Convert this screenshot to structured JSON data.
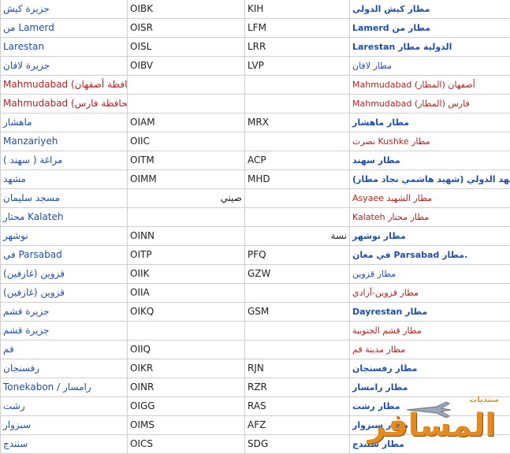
{
  "rows": [
    {
      "city": "جزيرة كيش",
      "icao": "OIBK",
      "iata": "KIH",
      "airport": "مطار كيش الدولي",
      "city_red": false,
      "airport_red": false
    },
    {
      "city": "من Lamerd",
      "icao": "OISR",
      "iata": "LFM",
      "airport": "Lamerd مطار من",
      "city_red": false,
      "airport_red": false
    },
    {
      "city": "Larestan",
      "icao": "OISL",
      "iata": "LRR",
      "airport": "Larestan الدولية مطار",
      "city_red": false,
      "airport_red": false
    },
    {
      "city": "جزيرة لافان",
      "icao": "OIBV",
      "iata": "LVP",
      "airport": "مطار لافان",
      "city_red": false,
      "airport_red": false,
      "airport_plain": true
    },
    {
      "city": "Mahmudabad (محافظة أصفهان)",
      "icao": "",
      "iata": "",
      "airport": "Mahmudabad أصفهان (المطار)",
      "city_red": true,
      "airport_red": true
    },
    {
      "city": "Mahmudabad (محافظة فارس)",
      "icao": "",
      "iata": "",
      "airport": "Mahmudabad فارس (المطار)",
      "city_red": true,
      "airport_red": true
    },
    {
      "city": "ماهشار",
      "icao": "OIAM",
      "iata": "MRX",
      "airport": "مطار ماهشار",
      "city_red": false,
      "airport_red": false
    },
    {
      "city": "Manzariyeh",
      "icao": "OIIC",
      "iata": "",
      "airport": "نصرت Kushke مطار",
      "city_red": false,
      "airport_red": true
    },
    {
      "city": "( مراغة ( سهند",
      "icao": "OITM",
      "iata": "ACP",
      "airport": "مطار سهند",
      "city_red": false,
      "airport_red": false
    },
    {
      "city": "مشهد",
      "icao": "OIMM",
      "iata": "MHD",
      "airport": "(مطار مشهد الدولي (شهيد هاشمي نجاد مطار",
      "city_red": false,
      "airport_red": false
    },
    {
      "city": "مسجد سليمان",
      "icao": "صيني",
      "iata": "",
      "airport": "Asyaee مطار الشهيد",
      "city_red": false,
      "airport_red": true,
      "icao_rtl": true
    },
    {
      "city": "محتار Kalateh",
      "icao": "",
      "iata": "",
      "airport": "Kalateh مطار محتار",
      "city_red": false,
      "airport_red": true
    },
    {
      "city": "نوشهر",
      "icao": "OINN",
      "iata": "نسة",
      "airport": "مطار نوشهر",
      "city_red": false,
      "airport_red": false,
      "iata_rtl": true
    },
    {
      "city": "في Parsabad",
      "icao": "OITP",
      "iata": "PFQ",
      "airport": "في مغان Parsabad مطار.",
      "city_red": false,
      "airport_red": false
    },
    {
      "city": "(قزوين (غازفين",
      "icao": "OIIK",
      "iata": "GZW",
      "airport": "مطار قزوين",
      "city_red": false,
      "airport_red": false,
      "airport_plain": true
    },
    {
      "city": "(قزوين (غازفين",
      "icao": "OIIA",
      "iata": "",
      "airport": "مطار قزوين-آزادي",
      "city_red": false,
      "airport_red": true
    },
    {
      "city": "جزيرة قشم",
      "icao": "OIKQ",
      "iata": "GSM",
      "airport": "Dayrestan مطار",
      "city_red": false,
      "airport_red": false
    },
    {
      "city": "جزيرة قشم",
      "icao": "",
      "iata": "",
      "airport": "مطار قشم الجنوبية",
      "city_red": false,
      "airport_red": true
    },
    {
      "city": "قم",
      "icao": "OIIQ",
      "iata": "",
      "airport": "مطار مدينة قم",
      "city_red": false,
      "airport_red": true
    },
    {
      "city": "رفسنجان",
      "icao": "OIKR",
      "iata": "RJN",
      "airport": "مطار رفسنجان",
      "city_red": false,
      "airport_red": false
    },
    {
      "city": "Tonekabon / رامسار",
      "icao": "OINR",
      "iata": "RZR",
      "airport": "مطار رامسار",
      "city_red": false,
      "airport_red": false
    },
    {
      "city": "رشت",
      "icao": "OIGG",
      "iata": "RAS",
      "airport": "مطار رشت",
      "city_red": false,
      "airport_red": false
    },
    {
      "city": "سبزوار",
      "icao": "OIMS",
      "iata": "AFZ",
      "airport": "مطار سبزوار",
      "city_red": false,
      "airport_red": false
    },
    {
      "city": "سنندج",
      "icao": "OICS",
      "iata": "SDG",
      "airport": "مطار سنندج",
      "city_red": false,
      "airport_red": false
    }
  ],
  "watermark": {
    "top_text": "منتديات",
    "main_text": "المسافر"
  },
  "colors": {
    "link_blue": "#1f4fa8",
    "link_red": "#b52020",
    "border": "#cfcfcf",
    "watermark_orange": "#e48a1e"
  }
}
